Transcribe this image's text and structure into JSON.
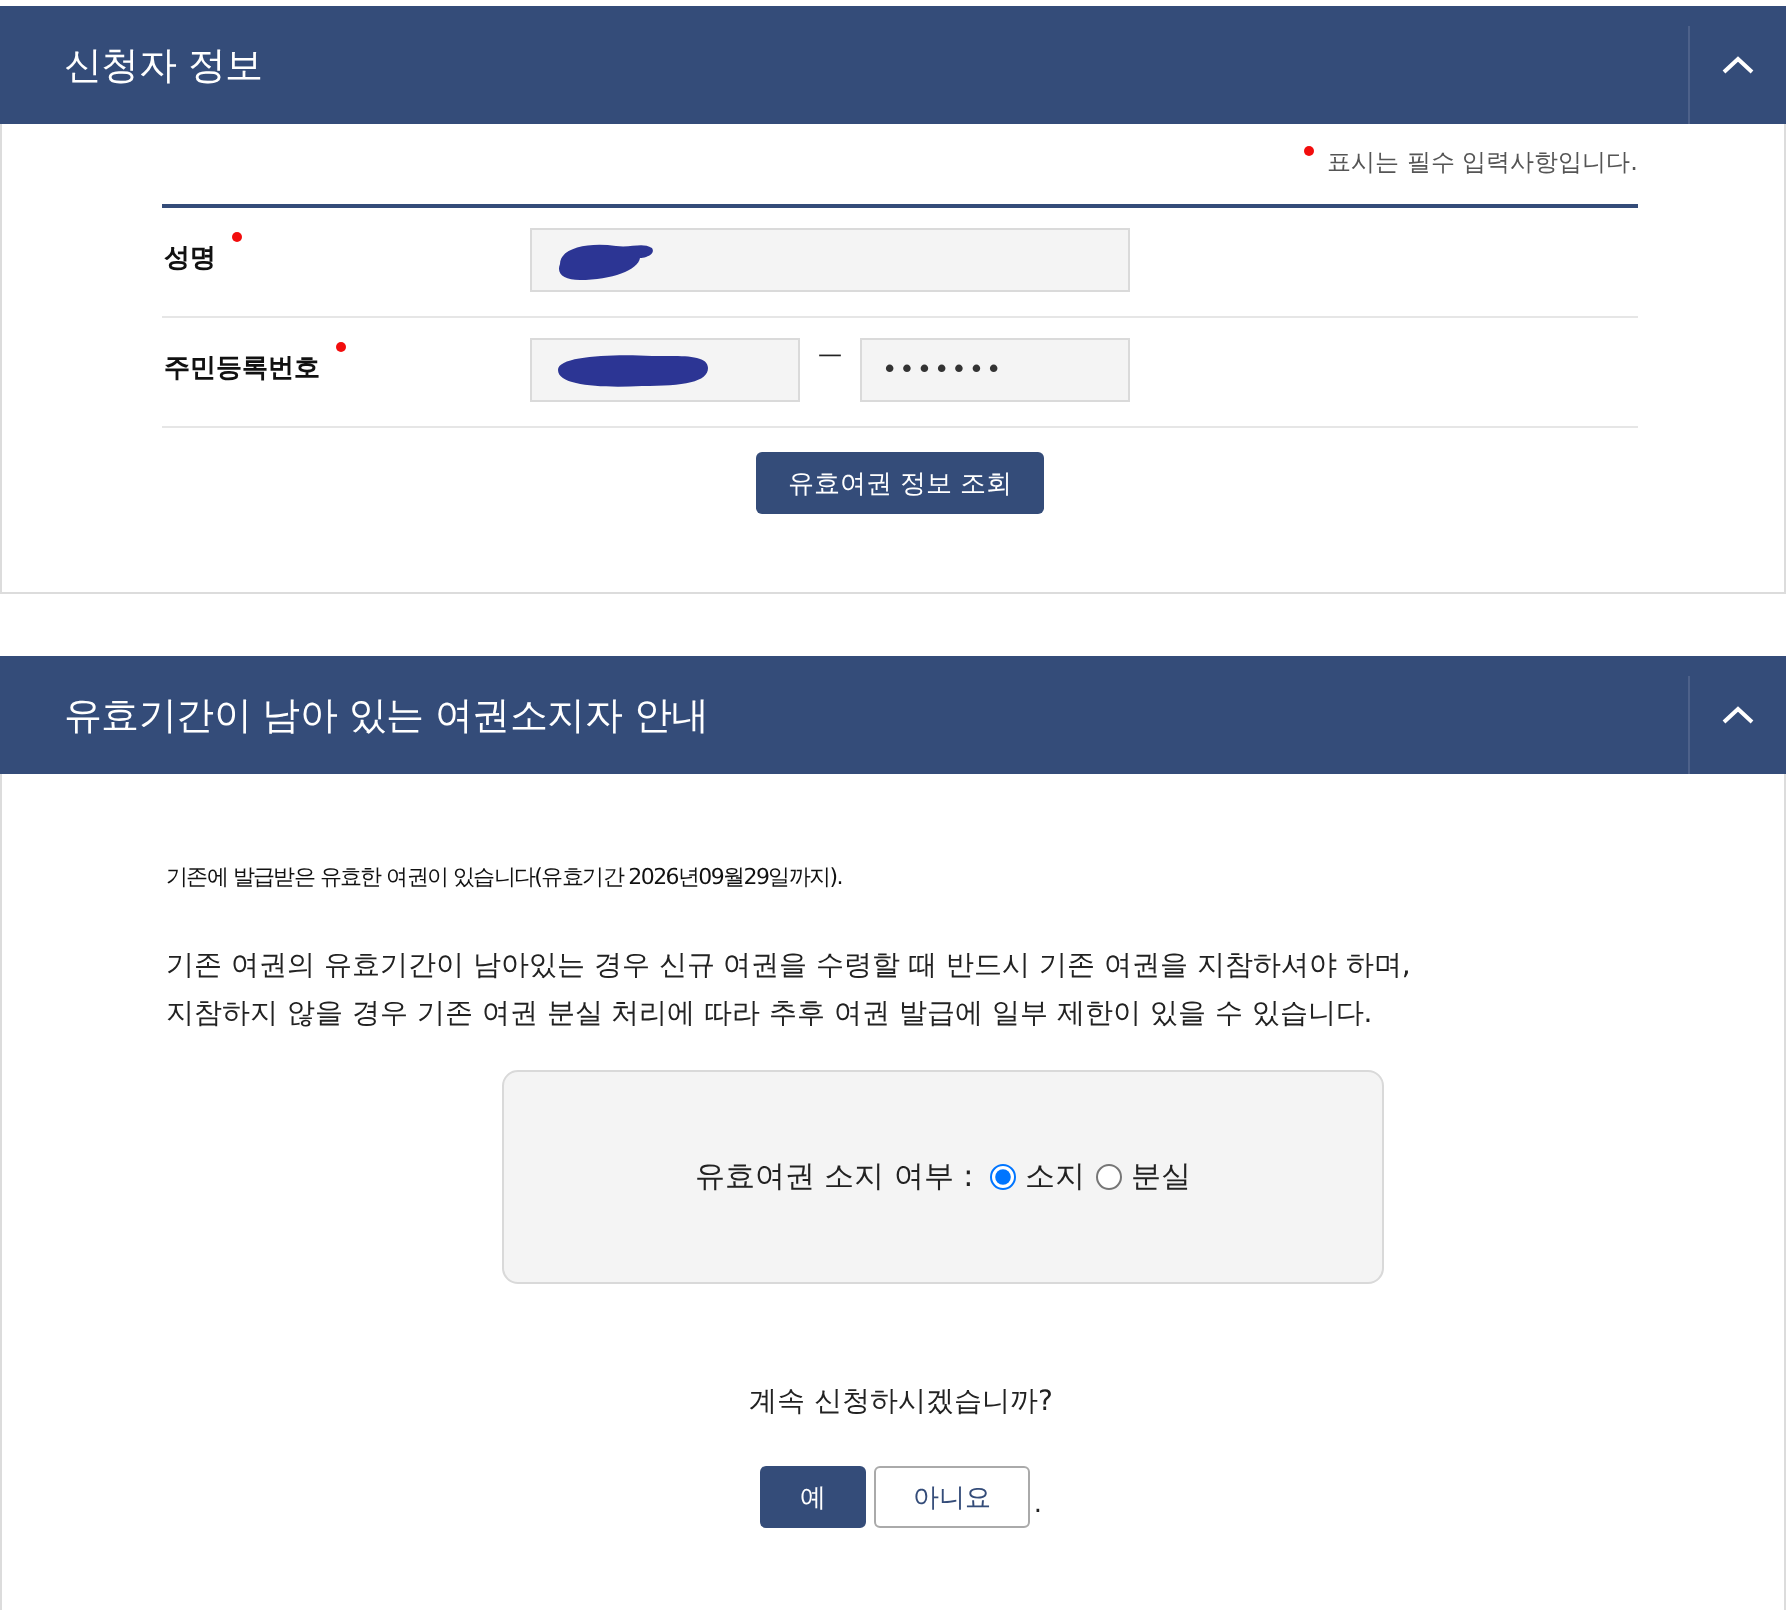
{
  "applicant_section": {
    "title": "신청자 정보",
    "expanded": true,
    "required_note": "표시는 필수 입력사항입니다.",
    "fields": [
      {
        "label": "성명",
        "required": true,
        "inputs": [
          {
            "kind": "redacted"
          }
        ]
      },
      {
        "label": "주민등록번호",
        "required": true,
        "separator": "—",
        "inputs": [
          {
            "kind": "redacted"
          },
          {
            "kind": "masked",
            "value": "•••••••"
          }
        ]
      }
    ],
    "lookup_button": "유효여권 정보 조회"
  },
  "notice_section": {
    "title": "유효기간이 남아 있는 여권소지자 안내",
    "expanded": true,
    "validity_note": "기존에 발급받은 유효한 여권이 있습니다(유효기간 2026년09월29일까지).",
    "guidance": "기존 여권의 유효기간이 남아있는 경우 신규 여권을 수령할 때 반드시 기존 여권을 지참하셔야 하며,\n지참하지 않을 경우 기존 여권 분실 처리에 따라 추후 여권 발급에 일부 제한이 있을 수 있습니다.",
    "possession": {
      "label": "유효여권 소지 여부 :",
      "options": [
        {
          "label": "소지",
          "selected": true
        },
        {
          "label": "분실",
          "selected": false
        }
      ]
    },
    "question": "계속 신청하시겠습니까?",
    "buttons": [
      {
        "label": "예",
        "kind": "primary"
      },
      {
        "label": "아니요",
        "kind": "secondary"
      }
    ],
    "trailing_mark": "."
  }
}
